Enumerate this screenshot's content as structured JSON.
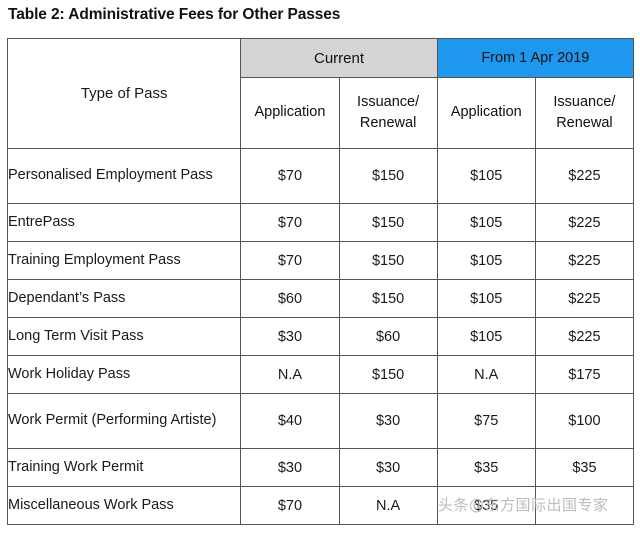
{
  "title": "Table 2: Administrative Fees for Other Passes",
  "table": {
    "row_header_label": "Type of Pass",
    "group_headers": [
      {
        "label": "Current",
        "bg": "#d4d4d4"
      },
      {
        "label": "From 1 Apr 2019",
        "bg": "#1e97ef"
      }
    ],
    "sub_headers": [
      {
        "line1": "Application",
        "line2": ""
      },
      {
        "line1": "Issuance/",
        "line2": "Renewal"
      },
      {
        "line1": "Application",
        "line2": ""
      },
      {
        "line1": "Issuance/",
        "line2": "Renewal"
      }
    ],
    "rows": [
      {
        "type": "Personalised Employment Pass",
        "current_application": "$70",
        "current_issuance_renewal": "$150",
        "new_application": "$105",
        "new_issuance_renewal": "$225"
      },
      {
        "type": "EntrePass",
        "current_application": "$70",
        "current_issuance_renewal": "$150",
        "new_application": "$105",
        "new_issuance_renewal": "$225"
      },
      {
        "type": "Training Employment Pass",
        "current_application": "$70",
        "current_issuance_renewal": "$150",
        "new_application": "$105",
        "new_issuance_renewal": "$225"
      },
      {
        "type": "Dependant’s Pass",
        "current_application": "$60",
        "current_issuance_renewal": "$150",
        "new_application": "$105",
        "new_issuance_renewal": "$225"
      },
      {
        "type": "Long Term Visit Pass",
        "current_application": "$30",
        "current_issuance_renewal": "$60",
        "new_application": "$105",
        "new_issuance_renewal": "$225"
      },
      {
        "type": "Work Holiday Pass",
        "current_application": "N.A",
        "current_issuance_renewal": "$150",
        "new_application": "N.A",
        "new_issuance_renewal": "$175"
      },
      {
        "type": "Work Permit (Performing Artiste)",
        "current_application": "$40",
        "current_issuance_renewal": "$30",
        "new_application": "$75",
        "new_issuance_renewal": "$100"
      },
      {
        "type": "Training Work Permit",
        "current_application": "$30",
        "current_issuance_renewal": "$30",
        "new_application": "$35",
        "new_issuance_renewal": "$35"
      },
      {
        "type": "Miscellaneous Work Pass",
        "current_application": "$70",
        "current_issuance_renewal": "N.A",
        "new_application": "$35",
        "new_issuance_renewal": ""
      }
    ]
  },
  "watermark": {
    "text": "头条@东方国际出国专家"
  },
  "colors": {
    "group_current_bg": "#d4d4d4",
    "group_new_bg": "#1e97ef",
    "border": "#555555",
    "text": "#1a1a1a",
    "watermark": "#b9b9b9"
  }
}
